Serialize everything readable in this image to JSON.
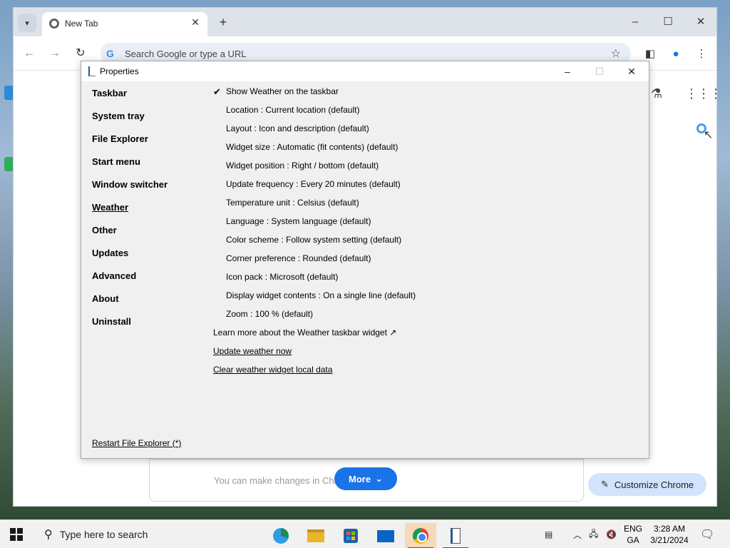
{
  "browser": {
    "tab_title": "New Tab",
    "omnibox_placeholder": "Search Google or type a URL",
    "more_button": "More",
    "customize_button": "Customize Chrome",
    "card_text": "You can make changes in Chrome"
  },
  "dialog": {
    "title": "Properties",
    "sidebar": [
      {
        "label": "Taskbar",
        "active": false
      },
      {
        "label": "System tray",
        "active": false
      },
      {
        "label": "File Explorer",
        "active": false
      },
      {
        "label": "Start menu",
        "active": false
      },
      {
        "label": "Window switcher",
        "active": false
      },
      {
        "label": "Weather",
        "active": true
      },
      {
        "label": "Other",
        "active": false
      },
      {
        "label": "Updates",
        "active": false
      },
      {
        "label": "Advanced",
        "active": false
      },
      {
        "label": "About",
        "active": false
      },
      {
        "label": "Uninstall",
        "active": false
      }
    ],
    "show_weather": {
      "label": "Show Weather on the taskbar",
      "checked": true,
      "check_glyph": "✔"
    },
    "options": [
      "Location : Current location (default)",
      "Layout : Icon and description (default)",
      "Widget size : Automatic (fit contents) (default)",
      "Widget position : Right / bottom (default)",
      "Update frequency : Every 20 minutes (default)",
      "Temperature unit : Celsius (default)",
      "Language : System language (default)",
      "Color scheme : Follow system setting (default)",
      "Corner preference : Rounded (default)",
      "Icon pack : Microsoft (default)",
      "Display widget contents : On a single line (default)",
      "Zoom : 100 % (default)"
    ],
    "learn_more": "Learn more about the Weather taskbar widget ↗",
    "update_now": "Update weather now",
    "clear_data": "Clear weather widget local data",
    "restart_explorer": "Restart File Explorer (*)"
  },
  "taskbar": {
    "search_placeholder": "Type here to search",
    "lang_line1": "ENG",
    "lang_line2": "GA",
    "time": "3:28 AM",
    "date": "3/21/2024"
  }
}
